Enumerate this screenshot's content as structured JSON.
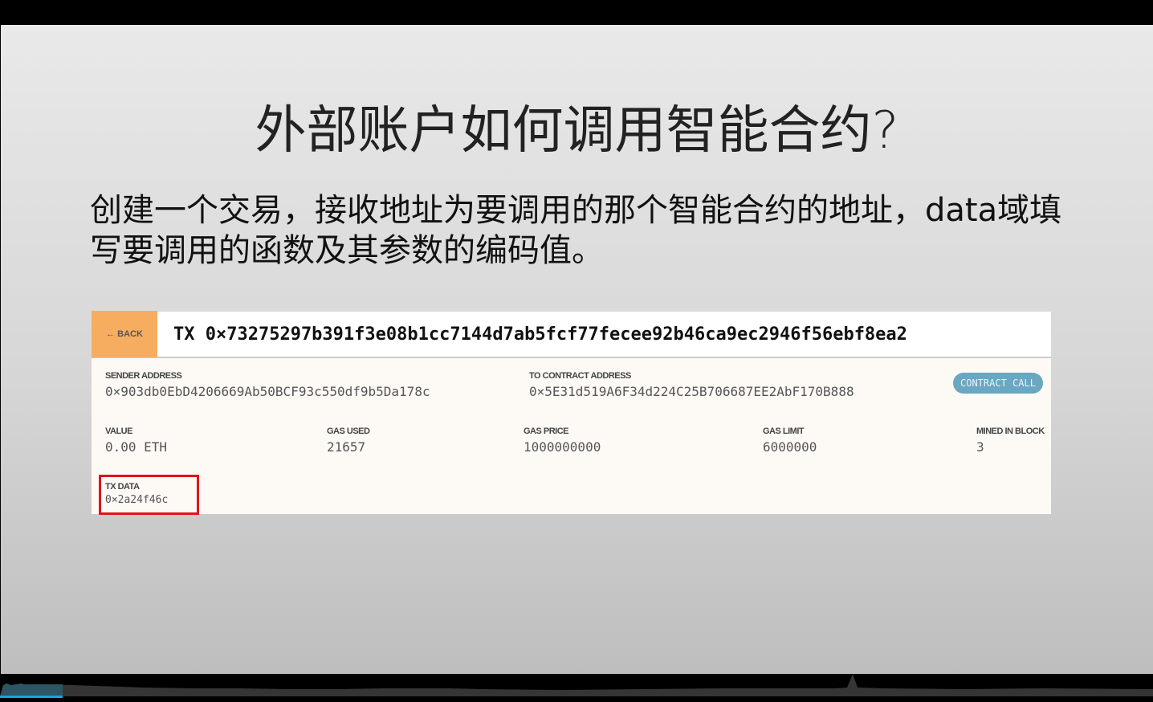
{
  "slide": {
    "title": "外部账户如何调用智能合约?",
    "body": "创建一个交易，接收地址为要调用的那个智能合约的地址，data域填写要调用的函数及其参数的编码值。"
  },
  "tx": {
    "back_label": "← BACK",
    "id": "TX 0×73275297b391f3e08b1cc7144d7ab5fcf77fecee92b46ca9ec2946f56ebf8ea2",
    "sender_label": "SENDER ADDRESS",
    "sender": "0×903db0EbD4206669Ab50BCF93c550df9b5Da178c",
    "to_label": "TO CONTRACT ADDRESS",
    "to": "0×5E31d519A6F34d224C25B706687EE2AbF170B888",
    "badge": "CONTRACT CALL",
    "value_label": "VALUE",
    "value": "0.00 ETH",
    "gas_used_label": "GAS USED",
    "gas_used": "21657",
    "gas_price_label": "GAS PRICE",
    "gas_price": "1000000000",
    "gas_limit_label": "GAS LIMIT",
    "gas_limit": "6000000",
    "block_label": "MINED IN BLOCK",
    "block": "3",
    "data_label": "TX DATA",
    "data": "0×2a24f46c"
  },
  "player": {
    "progress_percent": 5.4,
    "accent": "#1aa3e0"
  }
}
